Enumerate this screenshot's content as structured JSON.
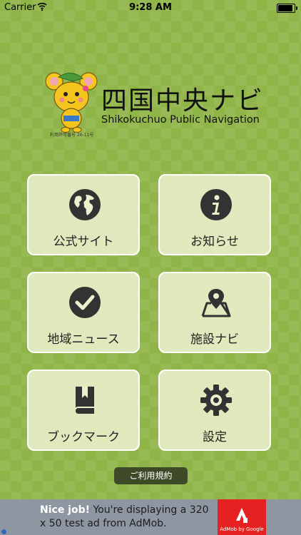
{
  "status_bar": {
    "carrier": "Carrier",
    "time": "9:28 AM",
    "battery_level": 1.0
  },
  "logo": {
    "title": "四国中央ナビ",
    "subtitle": "Shikokuchuo Public Navigation",
    "permit": "利用許可番号 26-11号",
    "mascot_icon": "mouse-mascot"
  },
  "tiles": [
    {
      "label": "公式サイト",
      "icon": "globe-icon"
    },
    {
      "label": "お知らせ",
      "icon": "info-icon"
    },
    {
      "label": "地域ニュース",
      "icon": "check-icon"
    },
    {
      "label": "施設ナビ",
      "icon": "map-pin-icon"
    },
    {
      "label": "ブックマーク",
      "icon": "bookmark-book-icon"
    },
    {
      "label": "設定",
      "icon": "gear-icon"
    }
  ],
  "terms_button": {
    "label": "ご利用規約"
  },
  "ad": {
    "headline": "Nice job!",
    "body": "You're displaying a 320 x 50 test ad from AdMob.",
    "badge": "AdMob by Google"
  },
  "colors": {
    "background": "#8fb548",
    "icon": "#333333",
    "ad_background": "#8e96a2",
    "ad_accent": "#e52121"
  }
}
